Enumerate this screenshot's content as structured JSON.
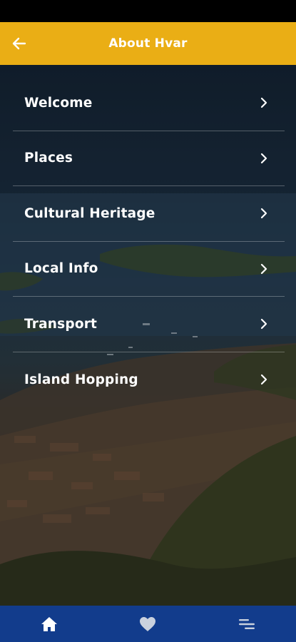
{
  "header": {
    "title": "About Hvar",
    "back_icon": "arrow-left-icon"
  },
  "menu": {
    "items": [
      {
        "label": "Welcome"
      },
      {
        "label": "Places"
      },
      {
        "label": "Cultural Heritage"
      },
      {
        "label": "Local Info"
      },
      {
        "label": "Transport"
      },
      {
        "label": "Island Hopping"
      }
    ]
  },
  "bottom_nav": {
    "items": [
      {
        "icon": "home-icon",
        "active": true
      },
      {
        "icon": "heart-icon",
        "active": false
      },
      {
        "icon": "menu-lines-icon",
        "active": false
      }
    ]
  },
  "colors": {
    "header": "#eaae15",
    "bottom_nav": "#123c8c",
    "status_bar": "#000000"
  }
}
